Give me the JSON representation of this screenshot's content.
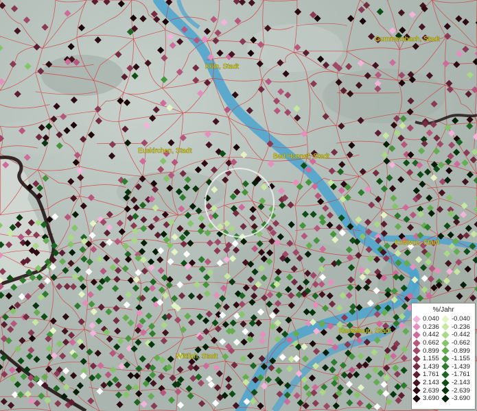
{
  "map": {
    "cities": [
      {
        "name": "Gummersbach, Stadt"
      },
      {
        "name": "Köln, Stadt"
      },
      {
        "name": "Euskirchen, Stadt"
      },
      {
        "name": "Bad Honnef, Stadt"
      },
      {
        "name": "Koblenz, Stadt"
      },
      {
        "name": "Kastellaun, Stadt"
      },
      {
        "name": "Wittlich, Stadt"
      }
    ],
    "colors": {
      "background": "#b9c3bd",
      "river": "#4aa3cf",
      "boundary": "#d2393c",
      "state_border": "#1a0c0c",
      "label": "#e6d200"
    }
  },
  "legend": {
    "title": "%/Jahr",
    "positive": [
      {
        "label": "0.040",
        "color": "#f3b3da"
      },
      {
        "label": "0.236",
        "color": "#e68fbd"
      },
      {
        "label": "0.442",
        "color": "#cf6b9a"
      },
      {
        "label": "0.662",
        "color": "#b8577d"
      },
      {
        "label": "0.899",
        "color": "#a04868"
      },
      {
        "label": "1.155",
        "color": "#8a3a55"
      },
      {
        "label": "1.439",
        "color": "#732c42"
      },
      {
        "label": "1.761",
        "color": "#5c1f31"
      },
      {
        "label": "2.143",
        "color": "#441420"
      },
      {
        "label": "2.639",
        "color": "#2e0b13"
      },
      {
        "label": "3.690",
        "color": "#1a0509"
      }
    ],
    "negative": [
      {
        "label": "-0.040",
        "color": "#e4f3c4"
      },
      {
        "label": "-0.236",
        "color": "#c8e8a2"
      },
      {
        "label": "-0.442",
        "color": "#a9d886"
      },
      {
        "label": "-0.662",
        "color": "#86c46a"
      },
      {
        "label": "-0.899",
        "color": "#64ad50"
      },
      {
        "label": "-1.155",
        "color": "#46943c"
      },
      {
        "label": "-1.439",
        "color": "#2f7c2e"
      },
      {
        "label": "-1.761",
        "color": "#1d6522"
      },
      {
        "label": "-2.143",
        "color": "#0f4d17"
      },
      {
        "label": "-2.639",
        "color": "#07360f"
      },
      {
        "label": "-3.690",
        "color": "#031f08"
      }
    ]
  }
}
